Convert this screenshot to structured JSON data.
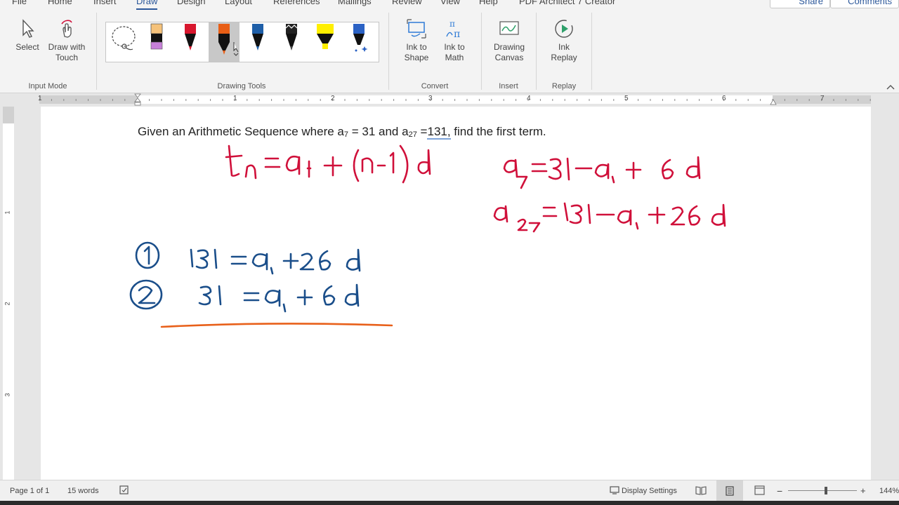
{
  "tabs": [
    "File",
    "Home",
    "Insert",
    "Draw",
    "Design",
    "Layout",
    "References",
    "Mailings",
    "Review",
    "View",
    "Help",
    "PDF Architect 7 Creator"
  ],
  "active_tab": "Draw",
  "header_buttons": {
    "share": "Share",
    "comments": "Comments"
  },
  "ribbon": {
    "input_mode": {
      "label": "Input Mode",
      "select": "Select",
      "draw_with_touch": [
        "Draw with",
        "Touch"
      ]
    },
    "drawing_tools": {
      "label": "Drawing Tools"
    },
    "convert": {
      "label": "Convert",
      "ink_to_shape": [
        "Ink to",
        "Shape"
      ],
      "ink_to_math": [
        "Ink to",
        "Math"
      ]
    },
    "insert": {
      "label": "Insert",
      "drawing_canvas": [
        "Drawing",
        "Canvas"
      ]
    },
    "replay": {
      "label": "Replay",
      "ink_replay": [
        "Ink",
        "Replay"
      ]
    }
  },
  "pens": [
    {
      "name": "lasso",
      "color": "#444444"
    },
    {
      "name": "pencil",
      "color": "#f5c27a"
    },
    {
      "name": "pen",
      "color": "#d8172e"
    },
    {
      "name": "pen",
      "color": "#e85e15",
      "selected": true
    },
    {
      "name": "pen",
      "color": "#1f5fa8"
    },
    {
      "name": "pen",
      "color": "#222222"
    },
    {
      "name": "highlighter",
      "color": "#ffef00"
    },
    {
      "name": "galaxy-pen",
      "color": "#2b62c4"
    }
  ],
  "ruler": {
    "h_numbers": [
      "1",
      "1",
      "2",
      "3",
      "4",
      "5",
      "6",
      "7"
    ],
    "v_numbers": [
      "1",
      "2",
      "3"
    ]
  },
  "document": {
    "question": {
      "pre": "Given an Arithmetic Sequence where a",
      "sub1": "7",
      "mid1": " = 31 and a",
      "sub2": "27",
      "mid2": " =",
      "value": "131,",
      "post": "  find the first term."
    }
  },
  "ink_colors": {
    "red": "#d0103a",
    "blue": "#1a4e8a",
    "orange": "#e8601a"
  },
  "status_bar": {
    "page": "Page 1 of 1",
    "words": "15 words",
    "display_settings": "Display Settings",
    "zoom": "144%"
  }
}
